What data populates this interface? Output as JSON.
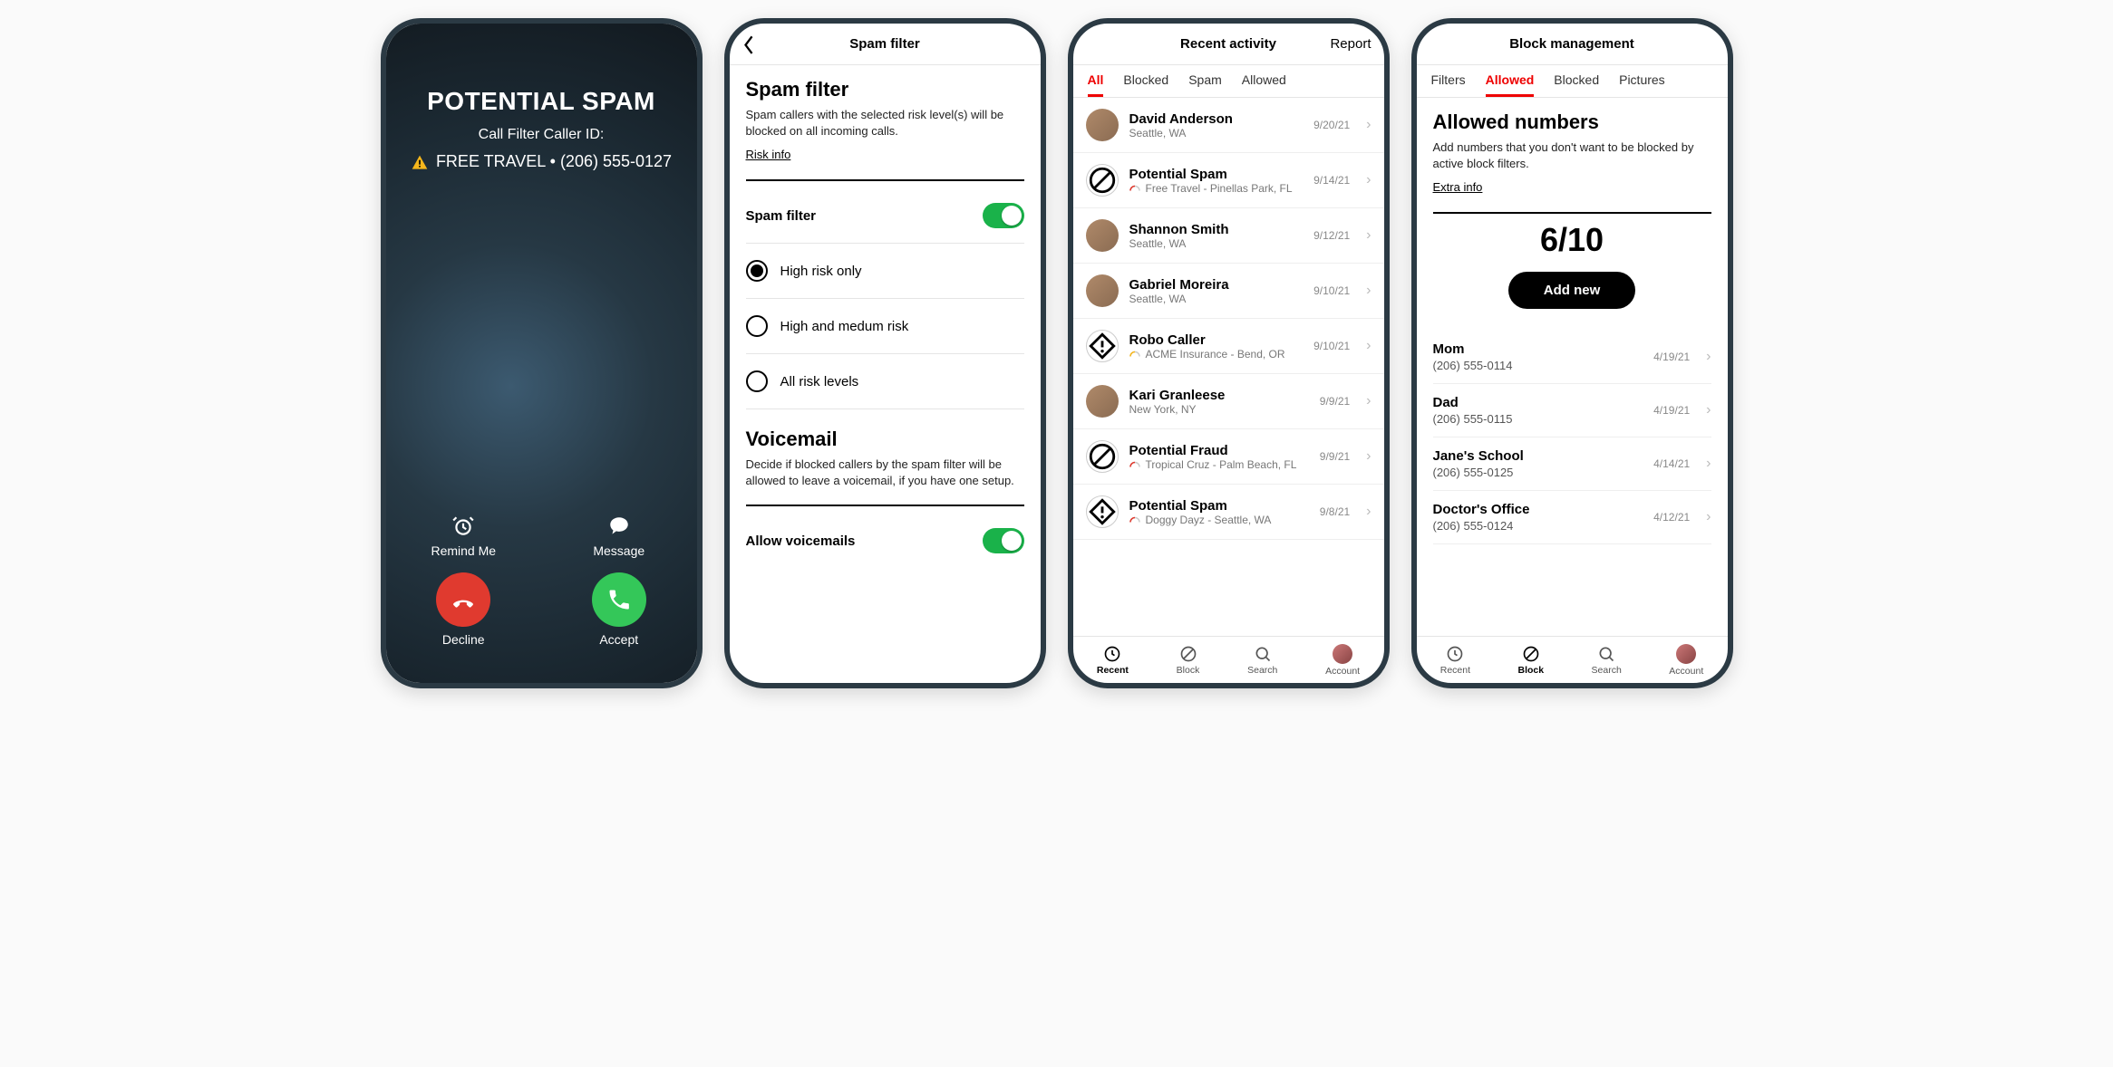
{
  "phone1": {
    "title": "POTENTIAL SPAM",
    "subtitle": "Call Filter Caller ID:",
    "caller_line": "FREE TRAVEL • (206) 555-0127",
    "remind_label": "Remind Me",
    "message_label": "Message",
    "decline_label": "Decline",
    "accept_label": "Accept"
  },
  "phone2": {
    "header_title": "Spam filter",
    "section_title": "Spam filter",
    "section_desc": "Spam callers with the selected risk level(s) will be blocked on all incoming calls.",
    "risk_link": "Risk info",
    "spam_filter_label": "Spam filter",
    "radios": [
      "High risk only",
      "High and medum risk",
      "All risk levels"
    ],
    "voicemail_title": "Voicemail",
    "voicemail_desc": "Decide if blocked callers by the spam filter will be allowed to leave a voicemail, if you have one setup.",
    "allow_vm_label": "Allow voicemails"
  },
  "phone3": {
    "header_title": "Recent activity",
    "header_right": "Report",
    "tabs": [
      "All",
      "Blocked",
      "Spam",
      "Allowed"
    ],
    "active_tab": "All",
    "items": [
      {
        "name": "David Anderson",
        "sub": "Seattle, WA",
        "date": "9/20/21",
        "type": "person"
      },
      {
        "name": "Potential Spam",
        "sub": "Free Travel - Pinellas Park, FL",
        "date": "9/14/21",
        "type": "spam",
        "gauge": "red"
      },
      {
        "name": "Shannon Smith",
        "sub": "Seattle, WA",
        "date": "9/12/21",
        "type": "person"
      },
      {
        "name": "Gabriel Moreira",
        "sub": "Seattle, WA",
        "date": "9/10/21",
        "type": "person"
      },
      {
        "name": "Robo Caller",
        "sub": "ACME Insurance - Bend, OR",
        "date": "9/10/21",
        "type": "warn",
        "gauge": "yellow"
      },
      {
        "name": "Kari Granleese",
        "sub": "New York, NY",
        "date": "9/9/21",
        "type": "person"
      },
      {
        "name": "Potential Fraud",
        "sub": "Tropical Cruz - Palm Beach, FL",
        "date": "9/9/21",
        "type": "spam",
        "gauge": "red"
      },
      {
        "name": "Potential Spam",
        "sub": "Doggy Dayz - Seattle, WA",
        "date": "9/8/21",
        "type": "warn",
        "gauge": "red"
      }
    ],
    "bottom": [
      "Recent",
      "Block",
      "Search",
      "Account"
    ],
    "bottom_active": "Recent"
  },
  "phone4": {
    "header_title": "Block management",
    "tabs": [
      "Filters",
      "Allowed",
      "Blocked",
      "Pictures"
    ],
    "active_tab": "Allowed",
    "section_title": "Allowed numbers",
    "section_desc": "Add numbers that you don't want to be blocked by active block filters.",
    "extra_link": "Extra info",
    "counter": "6/10",
    "add_new": "Add new",
    "items": [
      {
        "name": "Mom",
        "num": "(206) 555-0114",
        "date": "4/19/21"
      },
      {
        "name": "Dad",
        "num": "(206) 555-0115",
        "date": "4/19/21"
      },
      {
        "name": "Jane's School",
        "num": "(206) 555-0125",
        "date": "4/14/21"
      },
      {
        "name": "Doctor's Office",
        "num": "(206) 555-0124",
        "date": "4/12/21"
      }
    ],
    "bottom": [
      "Recent",
      "Block",
      "Search",
      "Account"
    ],
    "bottom_active": "Block"
  }
}
